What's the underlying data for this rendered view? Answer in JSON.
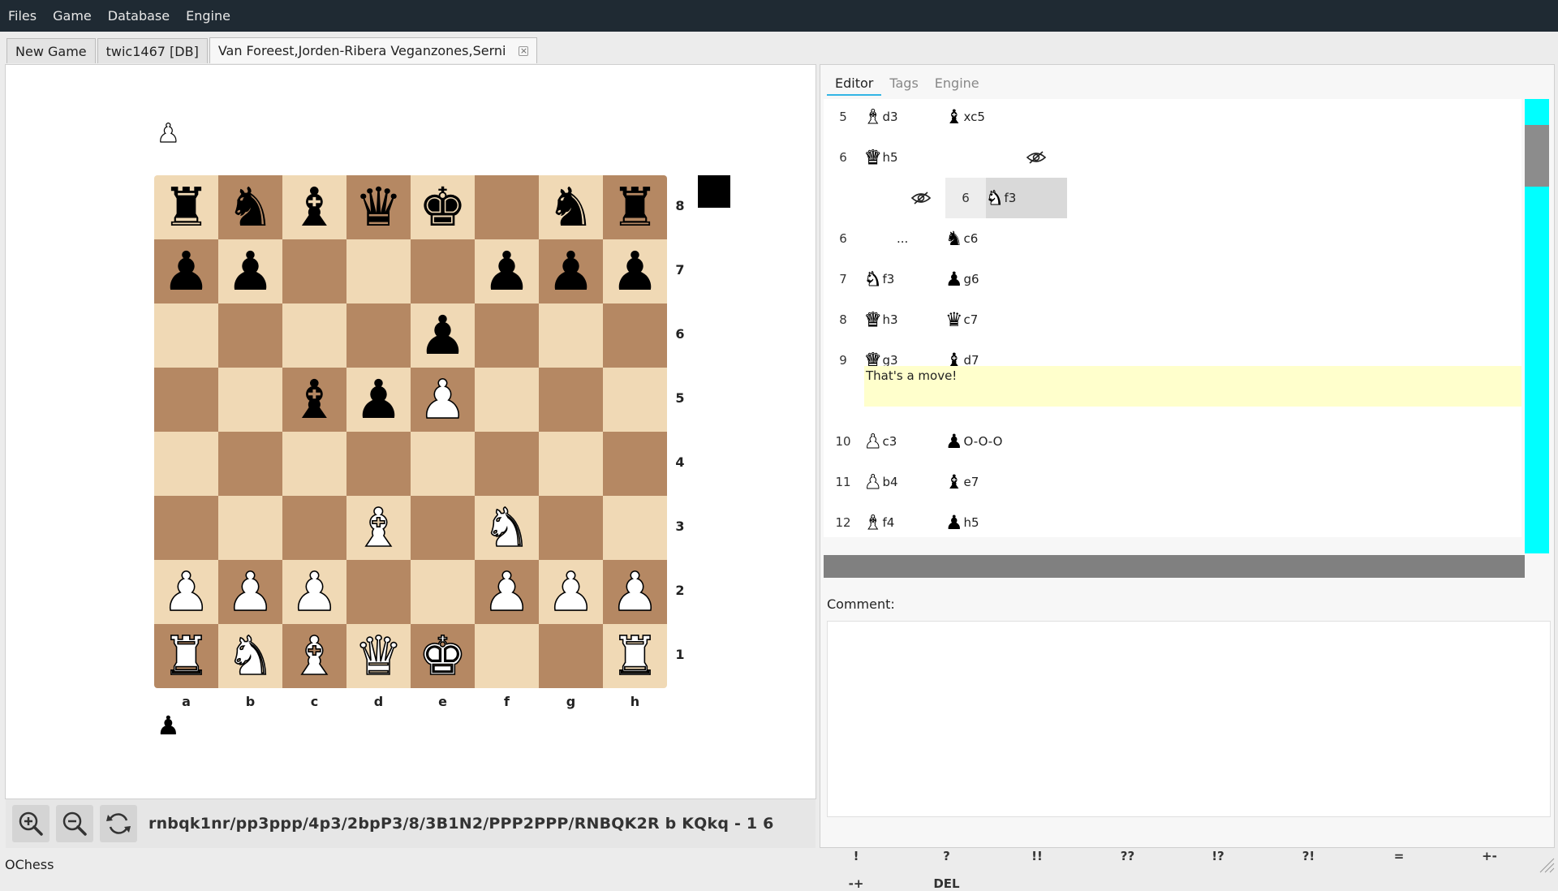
{
  "app": {
    "name": "OChess"
  },
  "menu": [
    "Files",
    "Game",
    "Database",
    "Engine"
  ],
  "tabs": [
    {
      "label": "New Game"
    },
    {
      "label": "twic1467 [DB]"
    },
    {
      "label": "Van Foreest,Jorden-Ribera Veganzones,Serni",
      "active": true,
      "closable": true
    }
  ],
  "board": {
    "ranks": [
      "8",
      "7",
      "6",
      "5",
      "4",
      "3",
      "2",
      "1"
    ],
    "files": [
      "a",
      "b",
      "c",
      "d",
      "e",
      "f",
      "g",
      "h"
    ],
    "position": [
      [
        "r",
        "n",
        "b",
        "q",
        "k",
        "",
        "n",
        "r"
      ],
      [
        "p",
        "p",
        "",
        "",
        "",
        "p",
        "p",
        "p"
      ],
      [
        "",
        "",
        "",
        "",
        "p",
        "",
        "",
        ""
      ],
      [
        "",
        "",
        "b",
        "p",
        "P",
        "",
        "",
        ""
      ],
      [
        "",
        "",
        "",
        "",
        "",
        "",
        "",
        ""
      ],
      [
        "",
        "",
        "",
        "B",
        "",
        "N",
        "",
        ""
      ],
      [
        "P",
        "P",
        "P",
        "",
        "",
        "P",
        "P",
        "P"
      ],
      [
        "R",
        "N",
        "B",
        "Q",
        "K",
        "",
        "",
        "R"
      ]
    ],
    "side_to_move": "black",
    "top_side_icon": "white-pawn-icon",
    "bottom_side_icon": "black-pawn-icon"
  },
  "toolbar": {
    "zoom_in_icon": "zoom-in-icon",
    "zoom_out_icon": "zoom-out-icon",
    "flip_icon": "flip-board-icon",
    "fen": "rnbqk1nr/pp3ppp/4p3/2bpP3/8/3B1N2/PPP2PPP/RNBQK2R b KQkq - 1 6"
  },
  "editor": {
    "tabs": [
      "Editor",
      "Tags",
      "Engine"
    ],
    "active_tab": "Editor",
    "moves": [
      {
        "num": "5",
        "white": {
          "piece": "B",
          "sq": "d3"
        },
        "black": {
          "piece": "b",
          "sq": "xc5"
        }
      },
      {
        "num": "6",
        "white": {
          "piece": "Q",
          "sq": "h5"
        },
        "black": null,
        "hide_icon_right": true
      },
      {
        "variation": true,
        "vnum": "6",
        "move": {
          "piece": "N",
          "sq": "f3"
        }
      },
      {
        "num": "6",
        "white_dots": "...",
        "black": {
          "piece": "n",
          "sq": "c6"
        }
      },
      {
        "num": "7",
        "white": {
          "piece": "N",
          "sq": "f3"
        },
        "black": {
          "piece": "p",
          "sq": "g6"
        }
      },
      {
        "num": "8",
        "white": {
          "piece": "Q",
          "sq": "h3"
        },
        "black": {
          "piece": "q",
          "sq": "c7"
        }
      },
      {
        "num": "9",
        "white": {
          "piece": "Q",
          "sq": "g3"
        },
        "black": {
          "piece": "b",
          "sq": "d7"
        }
      },
      {
        "num": "10",
        "white": {
          "piece": "P",
          "sq": "c3"
        },
        "black": {
          "piece": "p",
          "sq": "O-O-O"
        }
      },
      {
        "num": "11",
        "white": {
          "piece": "P",
          "sq": "b4"
        },
        "black": {
          "piece": "b",
          "sq": "e7"
        }
      },
      {
        "num": "12",
        "white": {
          "piece": "B",
          "sq": "f4"
        },
        "black": {
          "piece": "p",
          "sq": "h5"
        }
      }
    ],
    "move_comment": "That's a move!",
    "comment_label": "Comment:",
    "comment_value": "",
    "nags": [
      "!",
      "?",
      "!!",
      "??",
      "!?",
      "?!",
      "=",
      "+-",
      "-+",
      "DEL"
    ]
  },
  "colors": {
    "light_square": "#f0d9b5",
    "dark_square": "#b58863",
    "menubar": "#1f2a33",
    "scrollbar": "#00ffff",
    "comment_highlight": "#ffffcc"
  }
}
